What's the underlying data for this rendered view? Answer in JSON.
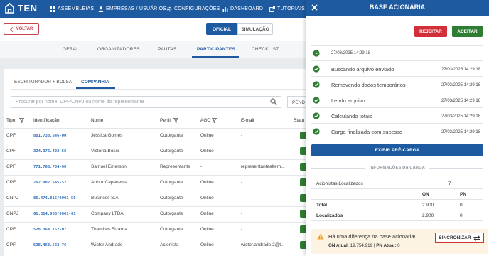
{
  "app": {
    "logo_text": "TEN"
  },
  "nav": {
    "items": [
      "ASSEMBLEIAS",
      "EMPRESAS / USUÁRIOS",
      "CONFIGURAÇÕES",
      "DASHBOARD",
      "TUTORIAIS"
    ]
  },
  "toolbar": {
    "back_label": "VOLTAR",
    "mode_official": "OFICIAL",
    "mode_simulation": "SIMULAÇÃO"
  },
  "tabs": [
    "GERAL",
    "ORGANIZADORES",
    "PAUTAS",
    "PARTICIPANTES",
    "CHECKLIST"
  ],
  "subtabs": [
    "ESCRITURADOR + BOLSA",
    "COMPANHIA"
  ],
  "search": {
    "placeholder": "Procurar por nome, CPF/CNPJ ou nome do representante",
    "side_label": "PEND"
  },
  "table": {
    "headers": [
      "Tipo",
      "Identificação",
      "Nome",
      "Perfil",
      "AGO",
      "E-mail",
      "Statu"
    ],
    "rows": [
      [
        "CPF",
        "801.738.646-00",
        "Jéssica Gomes",
        "Outorgante",
        "Online",
        "-"
      ],
      [
        "CPF",
        "324.376.402-58",
        "Victoria Bossi",
        "Outorgante",
        "Online",
        "-"
      ],
      [
        "CPF",
        "771.763.734-00",
        "Samuel Emerson",
        "Representante",
        "-",
        "representantealtern..."
      ],
      [
        "CPF",
        "762.982.545-52",
        "Arthur Capanema",
        "Outorgante",
        "Online",
        "-"
      ],
      [
        "CNPJ",
        "86.474.816/0001-50",
        "Business S.A",
        "Outorgante",
        "Online",
        "-"
      ],
      [
        "CNPJ",
        "61.314.866/0001-61",
        "Company LTDA",
        "Outorgante",
        "Online",
        "-"
      ],
      [
        "CPF",
        "528.364.152-07",
        "Thamires Bizarria",
        "Outorgante",
        "Online",
        "-"
      ],
      [
        "CPF",
        "528.468.523-76",
        "Wictor Andrade",
        "Acionista",
        "Online",
        "wictor.andrade.2@t..."
      ]
    ]
  },
  "panel": {
    "title": "BASE ACIONÁRIA",
    "reject_label": "REJEITAR",
    "accept_label": "ACEITAR",
    "first_step_time": "27/03/2025 14:29:18",
    "steps": [
      {
        "label": "Buscando arquivo enviado",
        "time": "27/03/2025 14:29:18"
      },
      {
        "label": "Removendo dados temporários",
        "time": "27/03/2025 14:29:18"
      },
      {
        "label": "Lendo arquivo",
        "time": "27/03/2025 14:29:18"
      },
      {
        "label": "Calculando totais",
        "time": "27/03/2025 14:29:18"
      },
      {
        "label": "Carga finalizada com sucesso",
        "time": "27/03/2025 14:29:18"
      }
    ],
    "preview_label": "EXIBIR PRÉ-CARGA",
    "info_title": "INFORMAÇÕES DA CARGA",
    "info": {
      "located_label": "Acionistas Localizados",
      "located_value": "7",
      "col_on": "ON",
      "col_pn": "PN",
      "total_label": "Total",
      "total_on": "2.900",
      "total_pn": "0",
      "loc_label": "Localizados",
      "loc_on": "2.900",
      "loc_pn": "0"
    },
    "warning": {
      "text": "Há uma diferença na base acionária!",
      "on_label": "ON Atual:",
      "on_value": "19.754.919",
      "pn_label": "PN Atual:",
      "pn_value": "0",
      "sync_label": "SINCRONIZAR"
    }
  },
  "colors": {
    "primary": "#1e5aa0",
    "danger": "#d32f3a",
    "success": "#2e7d32",
    "warning_bg": "#fdf3e3"
  }
}
